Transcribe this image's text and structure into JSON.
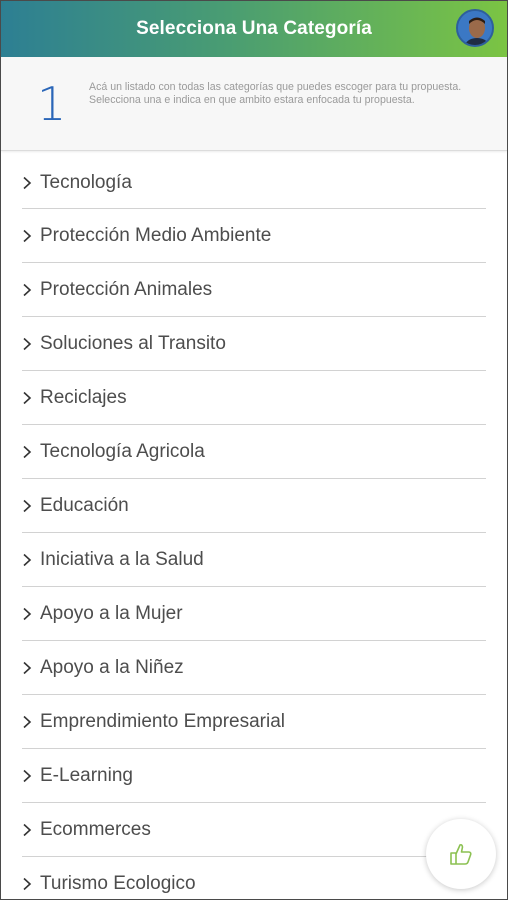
{
  "header": {
    "title": "Selecciona Una Categoría",
    "avatar_icon": "user-avatar",
    "gradient_start": "#2d7f93",
    "gradient_end": "#7bc443"
  },
  "intro": {
    "step_number": "1",
    "text": "Acá un listado con todas las categorías que puedes escoger para tu propuesta. Selecciona una e indica en que ambito estara enfocada tu propuesta."
  },
  "categories": [
    {
      "label": "Tecnología"
    },
    {
      "label": "Protección Medio Ambiente"
    },
    {
      "label": "Protección Animales"
    },
    {
      "label": "Soluciones al Transito"
    },
    {
      "label": "Reciclajes"
    },
    {
      "label": "Tecnología Agricola"
    },
    {
      "label": "Educación"
    },
    {
      "label": "Iniciativa a la Salud"
    },
    {
      "label": "Apoyo a la Mujer"
    },
    {
      "label": "Apoyo a la Niñez"
    },
    {
      "label": "Emprendimiento Empresarial"
    },
    {
      "label": "E-Learning"
    },
    {
      "label": "Ecommerces"
    },
    {
      "label": "Turismo Ecologico"
    }
  ],
  "fab": {
    "icon": "thumbs-up-icon",
    "color": "#8cc152"
  }
}
